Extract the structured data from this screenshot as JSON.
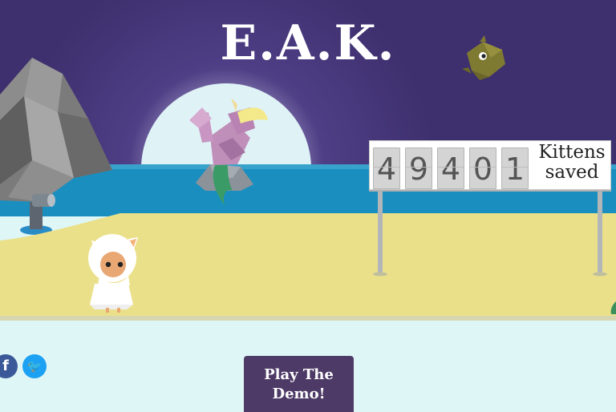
{
  "title": "E.A.K.",
  "counter": {
    "digits": [
      "4",
      "9",
      "4",
      "0",
      "1"
    ],
    "label_line1": "Kittens",
    "label_line2": "saved"
  },
  "social": {
    "facebook_glyph": "f",
    "twitter_glyph": "🐦"
  },
  "cta": {
    "play_line1": "Play The",
    "play_line2": "Demo!"
  },
  "colors": {
    "sky": "#3e2f6e",
    "sea": "#1a8fbf",
    "sand": "#ebe08a",
    "footer": "#dff6f7",
    "button": "#4d3a66",
    "facebook": "#3b5998",
    "twitter": "#1da1f2"
  }
}
